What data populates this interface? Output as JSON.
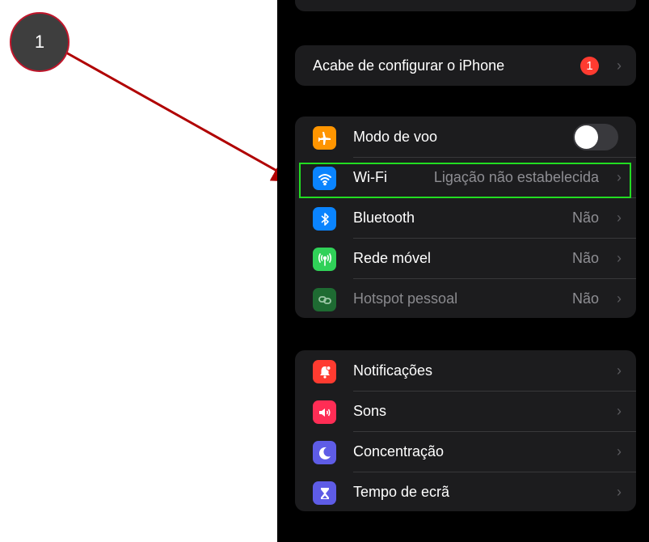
{
  "annotation": {
    "step_number": "1",
    "arrow_color": "#b00000",
    "highlight_color": "#22dd22"
  },
  "setup_group": {
    "label": "Acabe de configurar o iPhone",
    "badge": "1",
    "chevron": "›"
  },
  "connectivity_group": [
    {
      "label": "Modo de voo",
      "icon": "airplane-icon",
      "icon_color": "#ff9500",
      "control": "toggle",
      "toggle_on": false
    },
    {
      "label": "Wi-Fi",
      "icon": "wifi-icon",
      "icon_color": "#0a84ff",
      "value": "Ligação não estabelecida",
      "chevron": "›"
    },
    {
      "label": "Bluetooth",
      "icon": "bluetooth-icon",
      "icon_color": "#0a84ff",
      "value": "Não",
      "chevron": "›"
    },
    {
      "label": "Rede móvel",
      "icon": "antenna-icon",
      "icon_color": "#30d158",
      "value": "Não",
      "chevron": "›"
    },
    {
      "label": "Hotspot pessoal",
      "icon": "hotspot-icon",
      "icon_color": "#1e6b32",
      "value": "Não",
      "chevron": "›"
    }
  ],
  "general_group": [
    {
      "label": "Notificações",
      "icon": "bell-icon",
      "icon_color": "#ff3b30",
      "chevron": "›"
    },
    {
      "label": "Sons",
      "icon": "speaker-icon",
      "icon_color": "#ff2d55",
      "chevron": "›"
    },
    {
      "label": "Concentração",
      "icon": "moon-icon",
      "icon_color": "#5e5ce6",
      "chevron": "›"
    },
    {
      "label": "Tempo de ecrã",
      "icon": "hourglass-icon",
      "icon_color": "#5e5ce6",
      "chevron": "›"
    }
  ]
}
